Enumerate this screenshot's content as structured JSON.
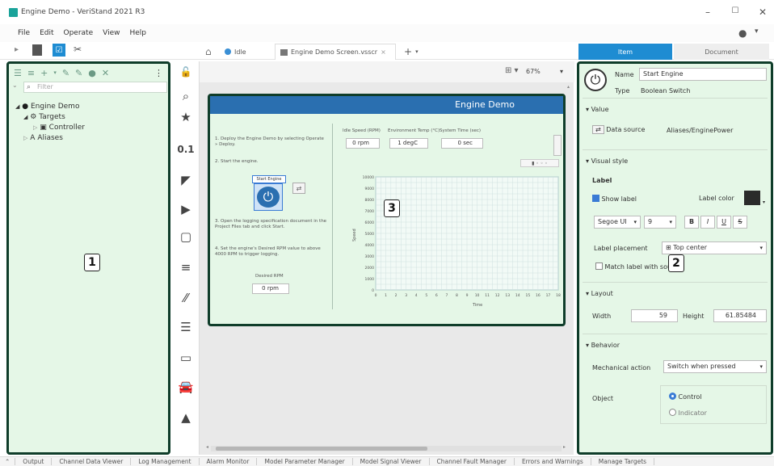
{
  "window": {
    "title": "Engine Demo - VeriStand 2021 R3"
  },
  "menu": [
    "File",
    "Edit",
    "Operate",
    "View",
    "Help"
  ],
  "doc_tabs": [
    {
      "label": "Idle"
    },
    {
      "label": "Engine Demo Screen.vsscr",
      "close": "×"
    }
  ],
  "left_panel": {
    "filter_placeholder": "Filter",
    "tree": [
      {
        "label": "Engine Demo",
        "level": 0
      },
      {
        "label": "Targets",
        "level": 1
      },
      {
        "label": "Controller",
        "level": 2
      },
      {
        "label": "Aliases",
        "level": 1
      }
    ]
  },
  "canvas": {
    "zoom": "67%"
  },
  "screen": {
    "title": "Engine Demo",
    "instructions": [
      "1. Deploy the Engine Demo by selecting Operate » Deploy.",
      "2. Start the engine.",
      "3. Open the logging specification document in the Project Files tab and click Start.",
      "4. Set the engine's Desired RPM value to above 4000 RPM to trigger logging."
    ],
    "start_label": "Start Engine",
    "desired_rpm_label": "Desired RPM",
    "desired_rpm_value": "0 rpm",
    "readouts": [
      {
        "label": "Idle Speed (RPM)",
        "value": "0 rpm"
      },
      {
        "label": "Environment Temp (°C)",
        "value": "1 degC"
      },
      {
        "label": "System Time (sec)",
        "value": "0 sec"
      }
    ],
    "graph": {
      "y_ticks": [
        "10000",
        "9000",
        "8000",
        "7000",
        "6000",
        "5000",
        "4000",
        "3000",
        "2000",
        "1000",
        "0"
      ],
      "x_ticks": [
        "0",
        "1",
        "2",
        "3",
        "4",
        "5",
        "6",
        "7",
        "8",
        "9",
        "10",
        "11",
        "12",
        "13",
        "14",
        "15",
        "16",
        "17",
        "18"
      ],
      "xlabel": "Time",
      "ylabel": "Speed"
    }
  },
  "right_panel": {
    "tabs": {
      "item": "Item",
      "document": "Document"
    },
    "name_label": "Name",
    "name_value": "Start Engine",
    "type_label": "Type",
    "type_value": "Boolean Switch",
    "value_section": "Value",
    "data_source_label": "Data source",
    "data_source_value": "Aliases/EnginePower",
    "visual_section": "Visual style",
    "label_heading": "Label",
    "show_label": "Show label",
    "label_color": "Label color",
    "font": "Segoe UI",
    "font_size": "9",
    "font_buttons": [
      "B",
      "I",
      "U",
      "S"
    ],
    "label_placement_label": "Label placement",
    "label_placement_value": "Top center",
    "match_label": "Match label with source",
    "layout_section": "Layout",
    "width_label": "Width",
    "width_value": "59",
    "height_label": "Height",
    "height_value": "61.85484",
    "behavior_section": "Behavior",
    "mech_label": "Mechanical action",
    "mech_value": "Switch when pressed",
    "object_label": "Object",
    "object_options": [
      "Control",
      "Indicator"
    ]
  },
  "callouts": [
    "1",
    "2",
    "3"
  ],
  "bottom_tabs": [
    "Output",
    "Channel Data Viewer",
    "Log Management",
    "Alarm Monitor",
    "Model Parameter Manager",
    "Model Signal Viewer",
    "Channel Fault Manager",
    "Errors and Warnings",
    "Manage Targets"
  ],
  "colors": {
    "accent_tab": "#1e8cd2",
    "highlight_panel": "#e5f7e7",
    "highlight_border": "#0f3d2a",
    "screen_header": "#2a6fb0"
  }
}
